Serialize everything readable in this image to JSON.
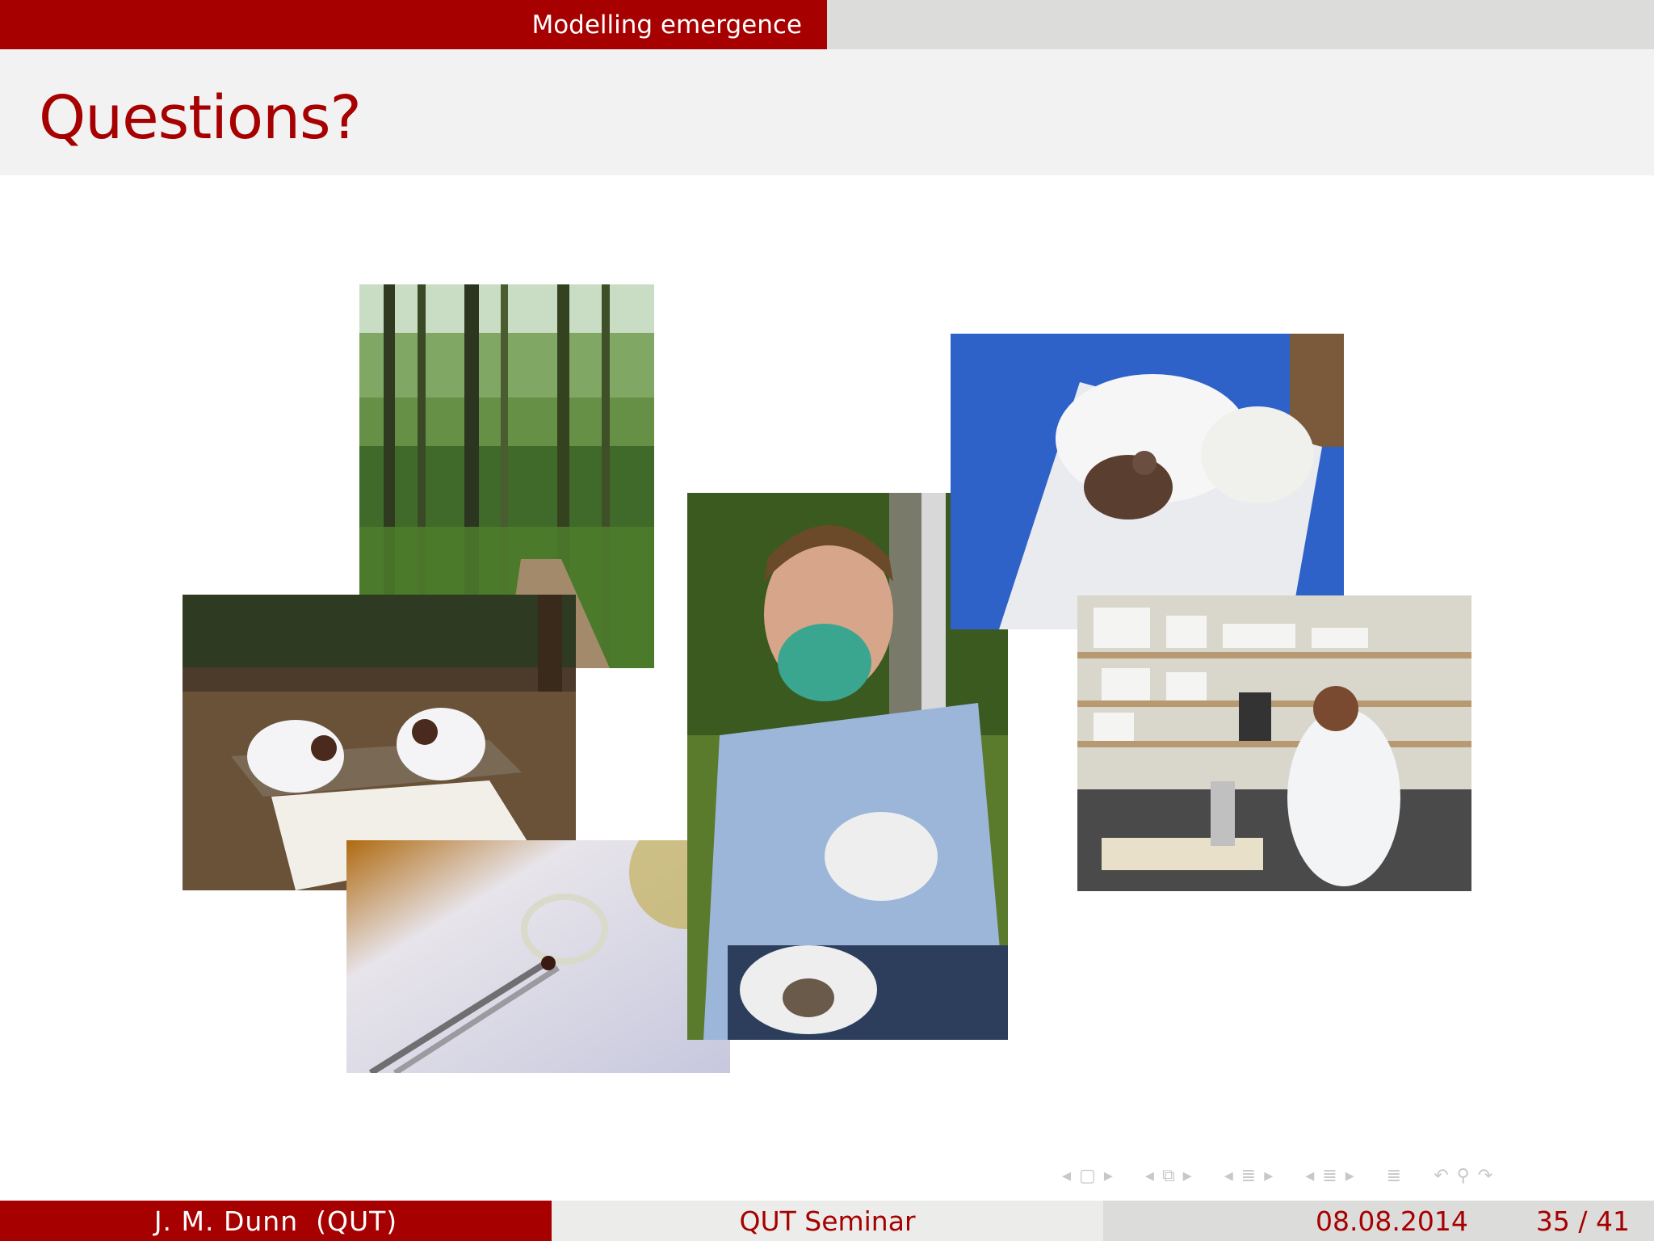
{
  "header": {
    "section": "Modelling emergence"
  },
  "frame": {
    "title": "Questions?"
  },
  "photos": [
    {
      "name": "forest-path-photo"
    },
    {
      "name": "field-researchers-photo"
    },
    {
      "name": "tick-in-tweezers-photo"
    },
    {
      "name": "researcher-with-mask-photo"
    },
    {
      "name": "mouse-in-tube-photo"
    },
    {
      "name": "lab-researcher-photo"
    }
  ],
  "nav": {
    "icons": [
      "frame-nav-icon",
      "subsection-nav-icon",
      "section-nav-icon",
      "document-nav-icon",
      "appendix-nav-icon",
      "search-nav-icon"
    ]
  },
  "footer": {
    "author": "J. M. Dunn",
    "institute": "(QUT)",
    "talk": "QUT Seminar",
    "date": "08.08.2014",
    "page": "35 / 41"
  },
  "colors": {
    "accent": "#a60000",
    "bar_light": "#f2f2f2",
    "bar_mid": "#dcdcda"
  }
}
